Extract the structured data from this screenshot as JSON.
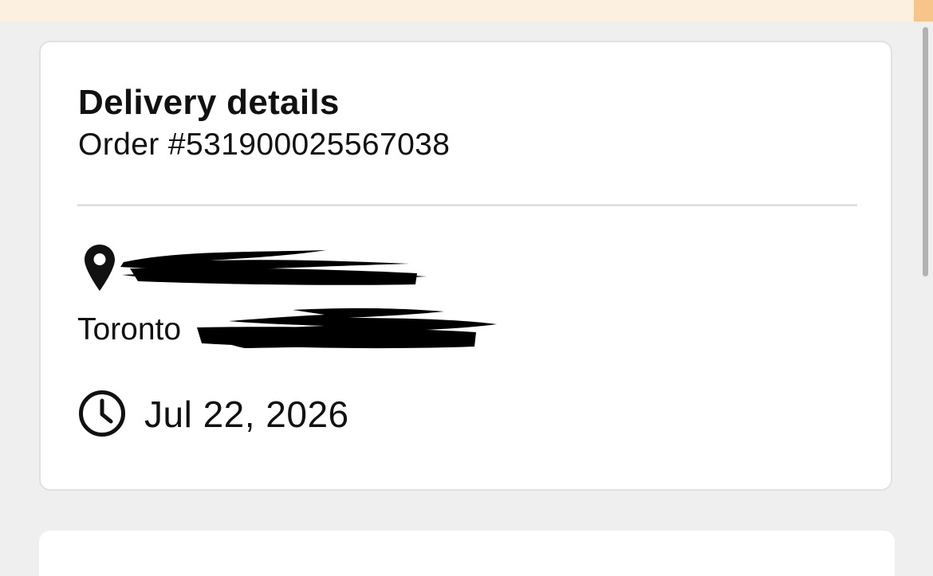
{
  "banner": {
    "accent_color": "#f7c589",
    "background_color": "#fcf0e1"
  },
  "delivery": {
    "title": "Delivery details",
    "order_number": "Order #531900025567038",
    "address_line1": "",
    "address_line2": "Toronto",
    "date": "Jul 22, 2026",
    "icons": {
      "location": "map-pin-icon",
      "time": "clock-icon"
    }
  }
}
